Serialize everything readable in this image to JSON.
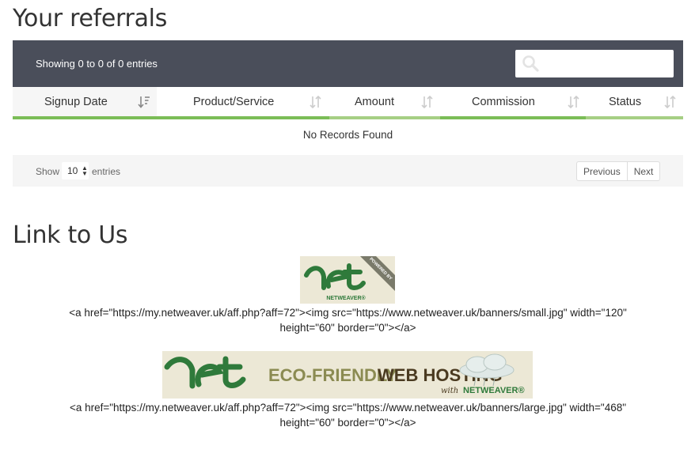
{
  "referrals": {
    "title": "Your referrals",
    "showing": "Showing 0 to 0 of 0 entries",
    "search": {
      "placeholder": ""
    },
    "columns": [
      "Signup Date",
      "Product/Service",
      "Amount",
      "Commission",
      "Status"
    ],
    "empty_message": "No Records Found",
    "length": {
      "show_label": "Show",
      "value": "10",
      "entries_label": "entries"
    },
    "pager": {
      "previous": "Previous",
      "next": "Next"
    }
  },
  "link_to_us": {
    "title": "Link to Us",
    "small_banner": {
      "powered_by": "POWERED BY",
      "brand": "NETWEAVER®",
      "code_line1": "<a href=\"https://my.netweaver.uk/aff.php?aff=72\"><img src=\"https://www.netweaver.uk/banners/small.jpg\" width=\"120\"",
      "code_line2": "height=\"60\" border=\"0\"></a>"
    },
    "large_banner": {
      "tagline_1": "ECO-FRIENDLY",
      "tagline_2": "WEB HOSTING",
      "with": "with",
      "brand": "NETWEAVER®",
      "code_line1": "<a href=\"https://my.netweaver.uk/aff.php?aff=72\"><img src=\"https://www.netweaver.uk/banners/large.jpg\" width=\"468\"",
      "code_line2": "height=\"60\" border=\"0\"></a>"
    }
  },
  "colors": {
    "header_bar": "#4a4e5a",
    "column_underline": "#a6cf84",
    "brand_green": "#2f7a3b",
    "banner_bg": "#ece8d6"
  }
}
